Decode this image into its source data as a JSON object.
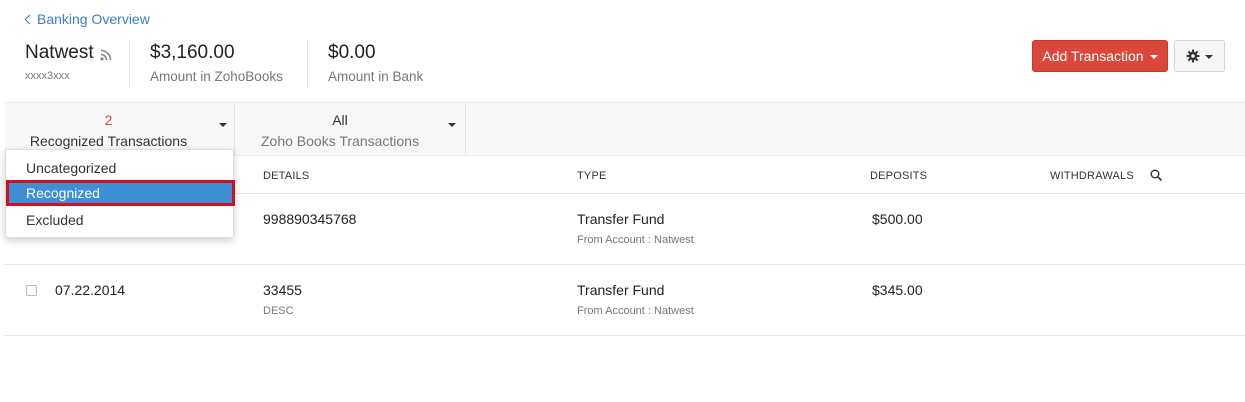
{
  "breadcrumb": {
    "label": "Banking Overview"
  },
  "account": {
    "name": "Natwest",
    "number": "xxxx3xxx"
  },
  "amounts": [
    {
      "value": "$3,160.00",
      "label": "Amount in ZohoBooks"
    },
    {
      "value": "$0.00",
      "label": "Amount in Bank"
    }
  ],
  "toolbar": {
    "add_label": "Add Transaction"
  },
  "filters": [
    {
      "count": "2",
      "label": "Recognized Transactions"
    },
    {
      "count": "All",
      "label": "Zoho Books Transactions"
    }
  ],
  "dropdown": {
    "items": [
      "Uncategorized",
      "Recognized",
      "Excluded"
    ],
    "selected": "Recognized"
  },
  "table": {
    "headers": [
      "DETAILS",
      "TYPE",
      "DEPOSITS",
      "WITHDRAWALS"
    ],
    "rows": [
      {
        "date": "",
        "details": "998890345768",
        "details_sub": "",
        "type": "Transfer Fund",
        "type_sub": "From Account : Natwest",
        "deposit": "$500.00",
        "withdrawal": ""
      },
      {
        "date": "07.22.2014",
        "details": "33455",
        "details_sub": "DESC",
        "type": "Transfer Fund",
        "type_sub": "From Account : Natwest",
        "deposit": "$345.00",
        "withdrawal": ""
      }
    ]
  },
  "colors": {
    "accent": "#d9483a",
    "link": "#3b7fc4",
    "selection": "#3f8fd6",
    "highlight_border": "#d20f1a",
    "count_red": "#d9483a"
  }
}
